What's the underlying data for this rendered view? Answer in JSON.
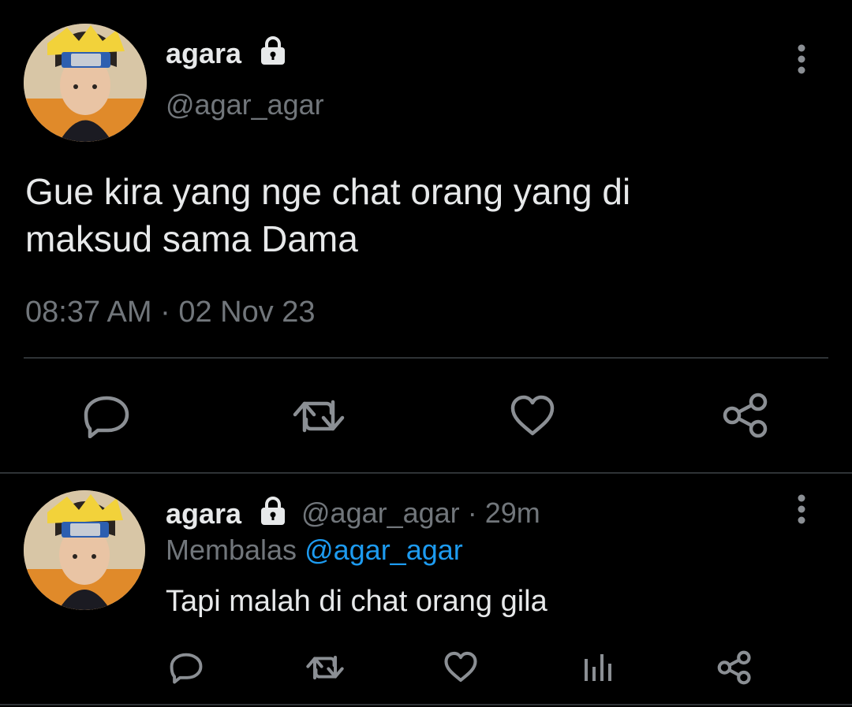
{
  "main_tweet": {
    "display_name": "agara",
    "handle": "@agar_agar",
    "text_line1": "Gue kira yang nge chat orang yang di",
    "text_line2": "maksud sama Dama",
    "timestamp": "08:37 AM · 02 Nov 23",
    "actions": [
      "reply-icon",
      "retweet-icon",
      "like-icon",
      "share-icon"
    ]
  },
  "reply_tweet": {
    "display_name": "agara",
    "handle": "@agar_agar",
    "time": "29m",
    "replying_prefix": "Membalas",
    "replying_to": "@agar_agar",
    "text": "Tapi malah di chat orang gila",
    "actions": [
      "reply-icon",
      "retweet-icon",
      "like-icon",
      "analytics-icon",
      "share-icon"
    ]
  },
  "colors": {
    "background": "#000000",
    "text": "#e7e9ea",
    "muted": "#71767b",
    "link": "#1d9bf0",
    "divider": "#2f3336"
  }
}
